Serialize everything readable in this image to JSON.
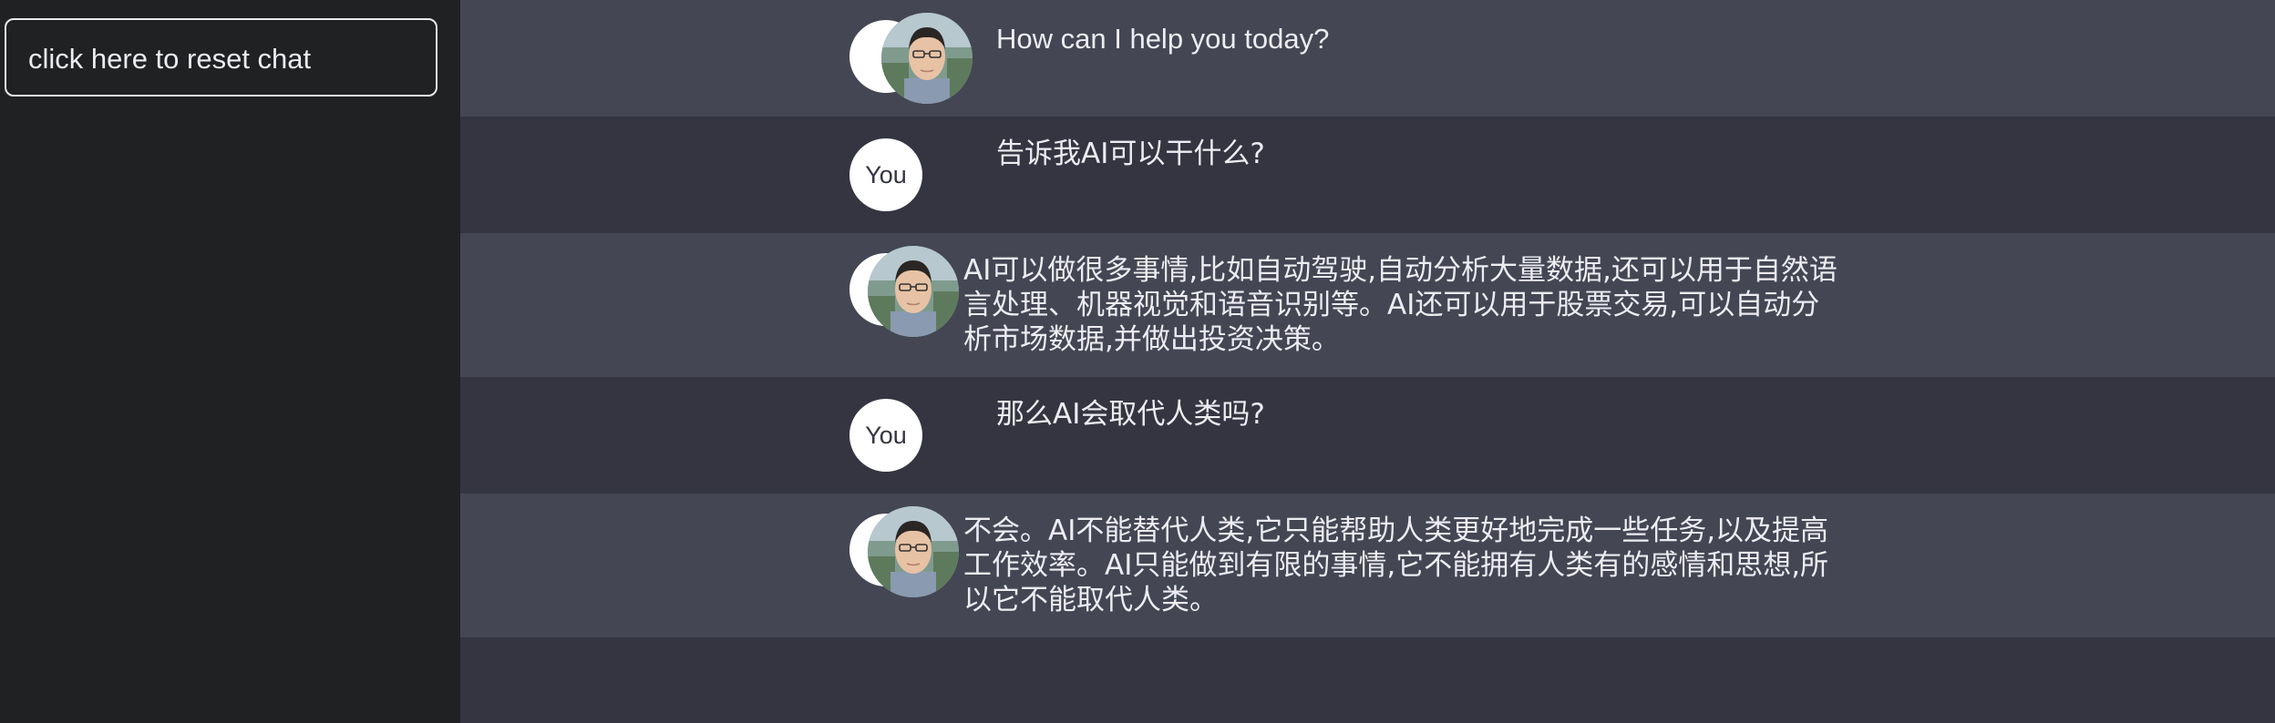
{
  "sidebar": {
    "reset_label": "click here to reset chat"
  },
  "messages": [
    {
      "role": "assistant",
      "text": "How can I help you today?"
    },
    {
      "role": "user",
      "avatar_label": "You",
      "text": "告诉我AI可以干什么?"
    },
    {
      "role": "assistant",
      "text": "AI可以做很多事情,比如自动驾驶,自动分析大量数据,还可以用于自然语言处理、机器视觉和语音识别等。AI还可以用于股票交易,可以自动分析市场数据,并做出投资决策。"
    },
    {
      "role": "user",
      "avatar_label": "You",
      "text": "那么AI会取代人类吗?"
    },
    {
      "role": "assistant",
      "text": "不会。AI不能替代人类,它只能帮助人类更好地完成一些任务,以及提高工作效率。AI只能做到有限的事情,它不能拥有人类有的感情和思想,所以它不能取代人类。"
    }
  ],
  "colors": {
    "sidebar_bg": "#202123",
    "chat_bg": "#343541",
    "assistant_row_bg": "#444654",
    "text": "#ececf1"
  }
}
